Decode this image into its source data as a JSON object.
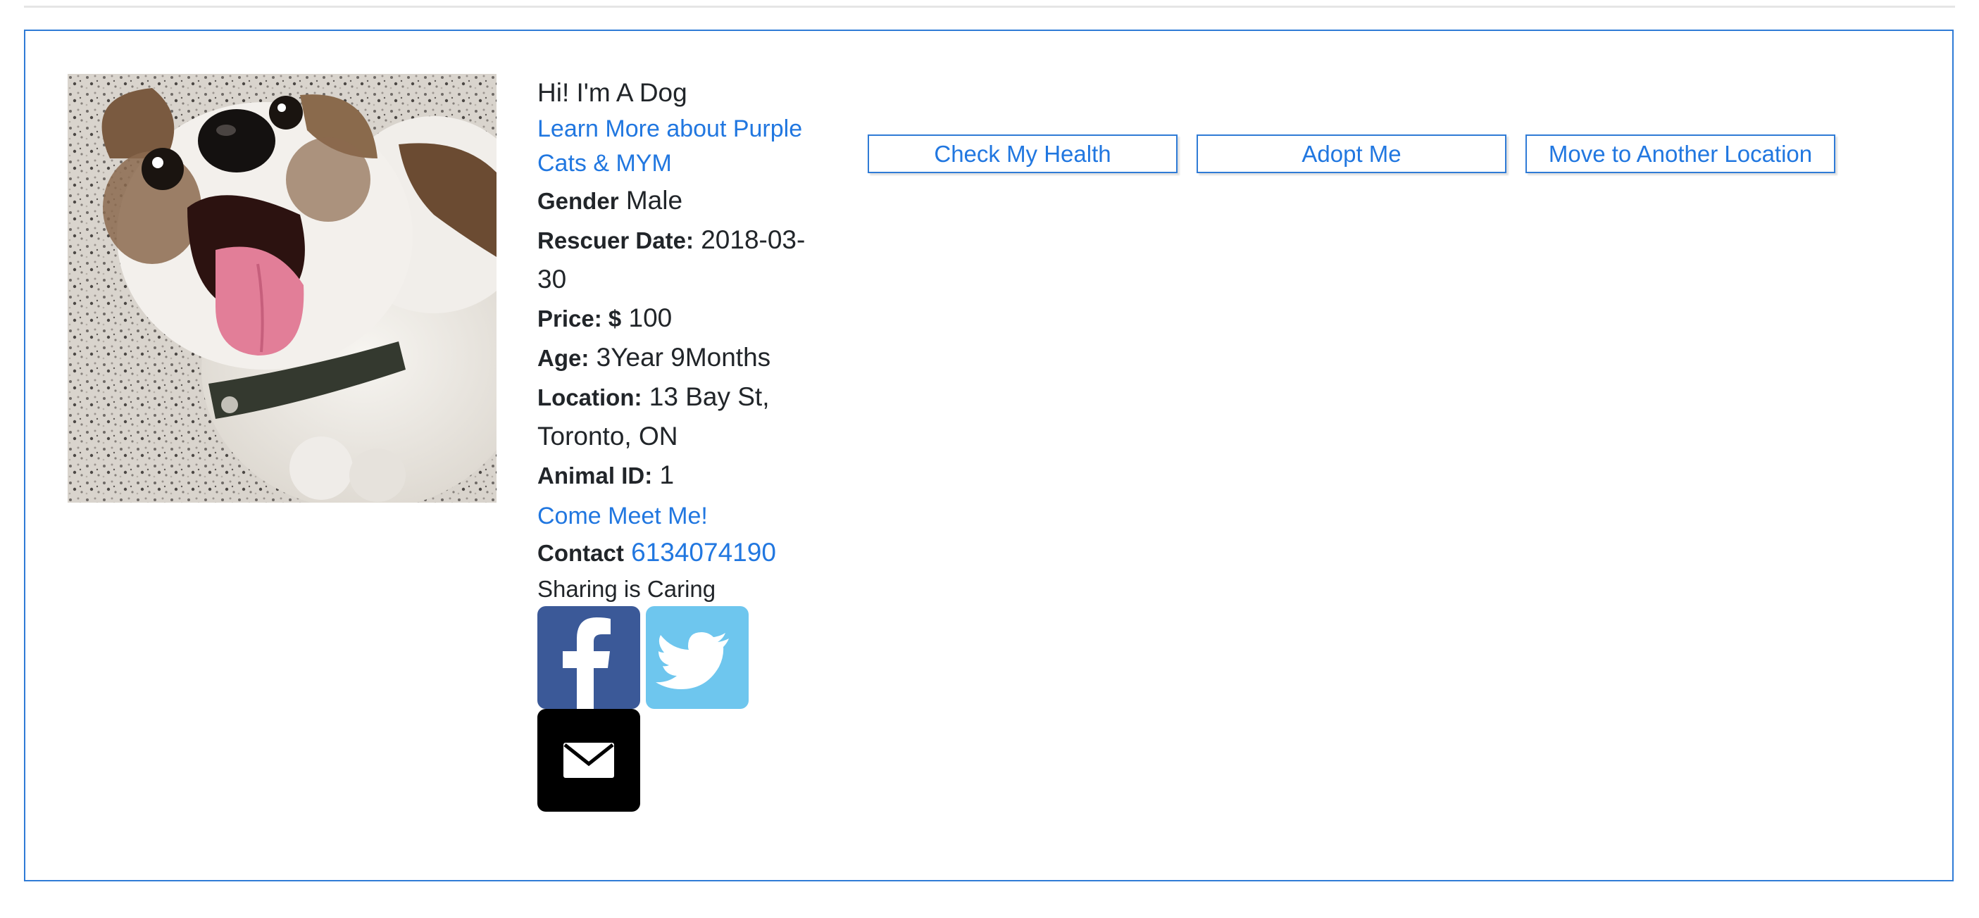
{
  "animal": {
    "greeting": "Hi! I'm A Dog",
    "learn_more_link": "Learn More about Purple Cats & MYM",
    "gender_label": "Gender",
    "gender": "Male",
    "rescuer_date_label": "Rescuer Date:",
    "rescuer_date": "2018-03-30",
    "price_label": "Price: $",
    "price": "100",
    "age_label": "Age:",
    "age": "3Year 9Months",
    "location_label": "Location:",
    "location": "13 Bay St, Toronto, ON",
    "animal_id_label": "Animal ID:",
    "animal_id": "1",
    "meet_link": "Come Meet Me!",
    "contact_label": "Contact",
    "phone": "6134074190",
    "sharing_text": "Sharing is Caring"
  },
  "actions": {
    "check_health": "Check My Health",
    "adopt": "Adopt Me",
    "move": "Move to Another Location"
  },
  "social": {
    "facebook_icon": "facebook-icon",
    "twitter_icon": "twitter-icon",
    "email_icon": "email-icon"
  },
  "colors": {
    "link": "#2177e0",
    "border": "#2f7bd6",
    "facebook": "#3b5998",
    "twitter": "#6ec6ee",
    "email": "#000000"
  }
}
